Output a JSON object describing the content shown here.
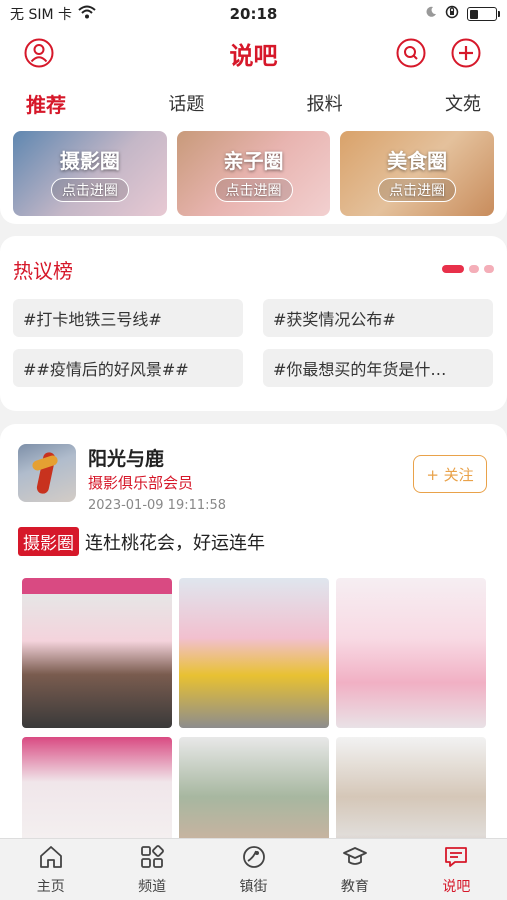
{
  "status_bar": {
    "carrier": "无 SIM 卡",
    "time": "20:18",
    "battery_level": 0.35
  },
  "header": {
    "title": "说吧",
    "left_icon": "user-icon",
    "right_icons": [
      "search-icon",
      "add-icon"
    ]
  },
  "tabs": [
    {
      "label": "推荐",
      "active": true
    },
    {
      "label": "话题",
      "active": false
    },
    {
      "label": "报料",
      "active": false
    },
    {
      "label": "文苑",
      "active": false
    }
  ],
  "circles": [
    {
      "name": "摄影圈",
      "button": "点击进圈"
    },
    {
      "name": "亲子圈",
      "button": "点击进圈"
    },
    {
      "name": "美食圈",
      "button": "点击进圈"
    }
  ],
  "hot_list": {
    "title": "热议榜",
    "topics": [
      "#打卡地铁三号线#",
      "#获奖情况公布#",
      "##疫情后的好风景##",
      "#你最想买的年货是什…"
    ]
  },
  "post": {
    "author": "阳光与鹿",
    "author_tag": "摄影俱乐部会员",
    "time": "2023-01-09 19:11:58",
    "follow_label": "+ 关注",
    "circle_tag": "摄影圈",
    "text": "连杜桃花会，好运连年",
    "photo_count": 6
  },
  "tabbar": [
    {
      "label": "主页",
      "icon": "home-icon",
      "active": false
    },
    {
      "label": "频道",
      "icon": "channels-icon",
      "active": false
    },
    {
      "label": "镇街",
      "icon": "town-icon",
      "active": false
    },
    {
      "label": "教育",
      "icon": "education-icon",
      "active": false
    },
    {
      "label": "说吧",
      "icon": "chat-icon",
      "active": true
    }
  ],
  "colors": {
    "accent": "#d6182a",
    "follow": "#e9a24a",
    "background": "#f2f2f2"
  }
}
